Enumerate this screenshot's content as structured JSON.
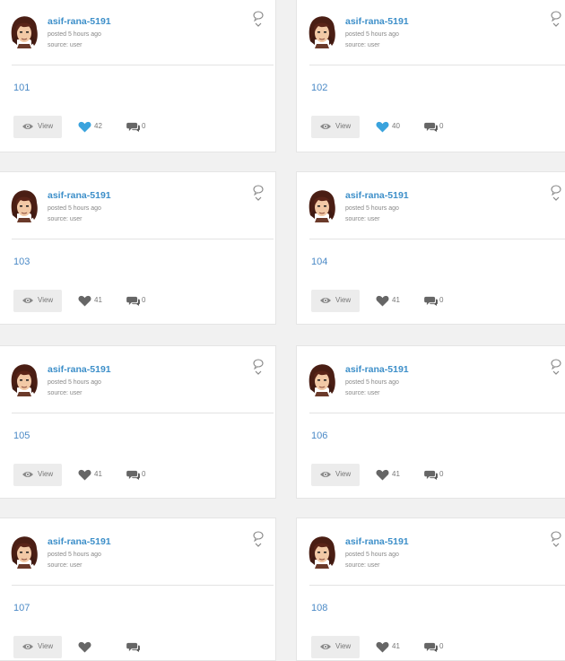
{
  "colors": {
    "link": "#3d8fc9",
    "like_active": "#3aa3dd",
    "like_inactive": "#666666",
    "button_bg": "#ececec"
  },
  "cards": [
    {
      "author": "asif-rana-5191",
      "posted": "posted 5 hours ago",
      "source": "source: user",
      "title": "101",
      "view_label": "View",
      "likes": "42",
      "comments": "0",
      "liked": true
    },
    {
      "author": "asif-rana-5191",
      "posted": "posted 5 hours ago",
      "source": "source: user",
      "title": "102",
      "view_label": "View",
      "likes": "40",
      "comments": "0",
      "liked": true
    },
    {
      "author": "asif-rana-5191",
      "posted": "posted 5 hours ago",
      "source": "source: user",
      "title": "103",
      "view_label": "View",
      "likes": "41",
      "comments": "0",
      "liked": false
    },
    {
      "author": "asif-rana-5191",
      "posted": "posted 5 hours ago",
      "source": "source: user",
      "title": "104",
      "view_label": "View",
      "likes": "41",
      "comments": "0",
      "liked": false
    },
    {
      "author": "asif-rana-5191",
      "posted": "posted 5 hours ago",
      "source": "source: user",
      "title": "105",
      "view_label": "View",
      "likes": "41",
      "comments": "0",
      "liked": false
    },
    {
      "author": "asif-rana-5191",
      "posted": "posted 5 hours ago",
      "source": "source: user",
      "title": "106",
      "view_label": "View",
      "likes": "41",
      "comments": "0",
      "liked": false
    },
    {
      "author": "asif-rana-5191",
      "posted": "posted 5 hours ago",
      "source": "source: user",
      "title": "107",
      "view_label": "View",
      "likes": "",
      "comments": "",
      "liked": false
    },
    {
      "author": "asif-rana-5191",
      "posted": "posted 5 hours ago",
      "source": "source: user",
      "title": "108",
      "view_label": "View",
      "likes": "41",
      "comments": "0",
      "liked": false
    }
  ]
}
